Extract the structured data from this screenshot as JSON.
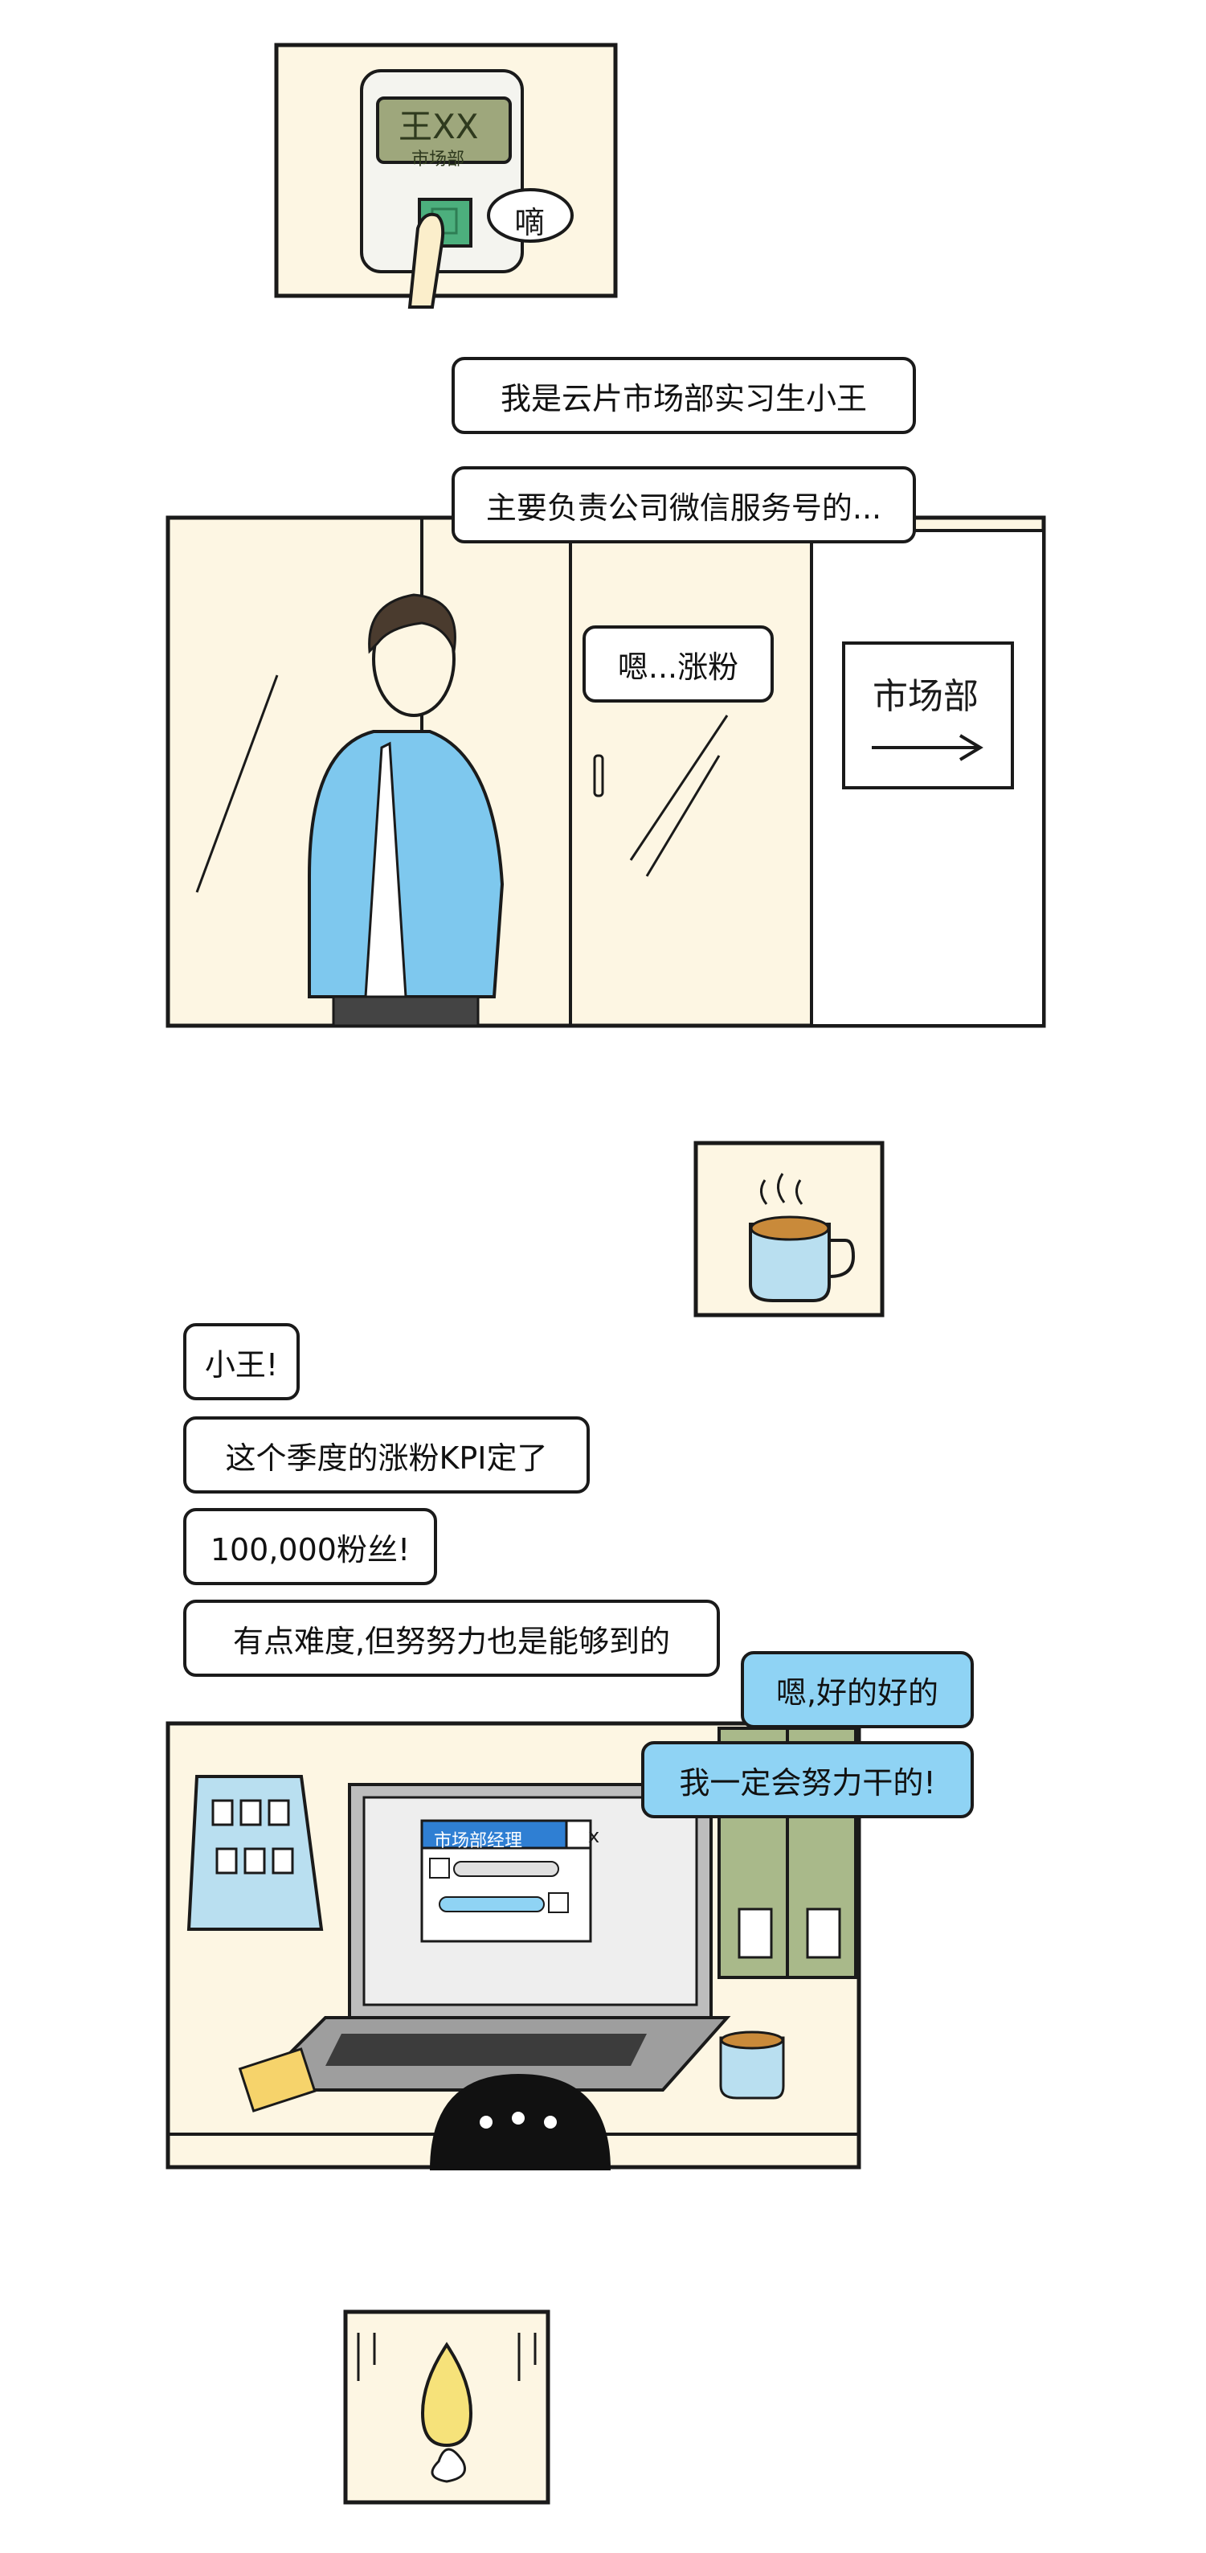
{
  "colors": {
    "panel_bg": "#fdf6e3",
    "outline": "#1a1a1a",
    "jacket_blue": "#7ec8ee",
    "bubble_blue": "#8fd3f4",
    "card_screen": "#9ea77c",
    "card_button": "#4caf7d",
    "binder_green": "#a9b98a",
    "sticky_yellow": "#f6d36b",
    "calendar_blue": "#b9dff0",
    "window_blue": "#2f7fd3"
  },
  "panel1": {
    "card_name": "王XX",
    "card_dept": "市场部",
    "beep": "嘀"
  },
  "panel2": {
    "speech_1": "我是云片市场部实习生小王",
    "speech_2": "主要负责公司微信服务号的...",
    "speech_3": "嗯...涨粉",
    "sign_label": "市场部"
  },
  "panel4": {
    "speech_1": "小王!",
    "speech_2": "这个季度的涨粉KPI定了",
    "speech_3": "100,000粉丝!",
    "speech_4": "有点难度,但努努力也是能够到的",
    "reply_1": "嗯,好的好的",
    "reply_2": "我一定会努力干的!",
    "chat_window_title": "市场部经理",
    "chat_close": "x"
  },
  "icons": [
    "fingerprint-button-icon",
    "tea-mug-icon",
    "arrow-right-icon",
    "calendar-icon",
    "laptop-icon",
    "pear-icon"
  ]
}
